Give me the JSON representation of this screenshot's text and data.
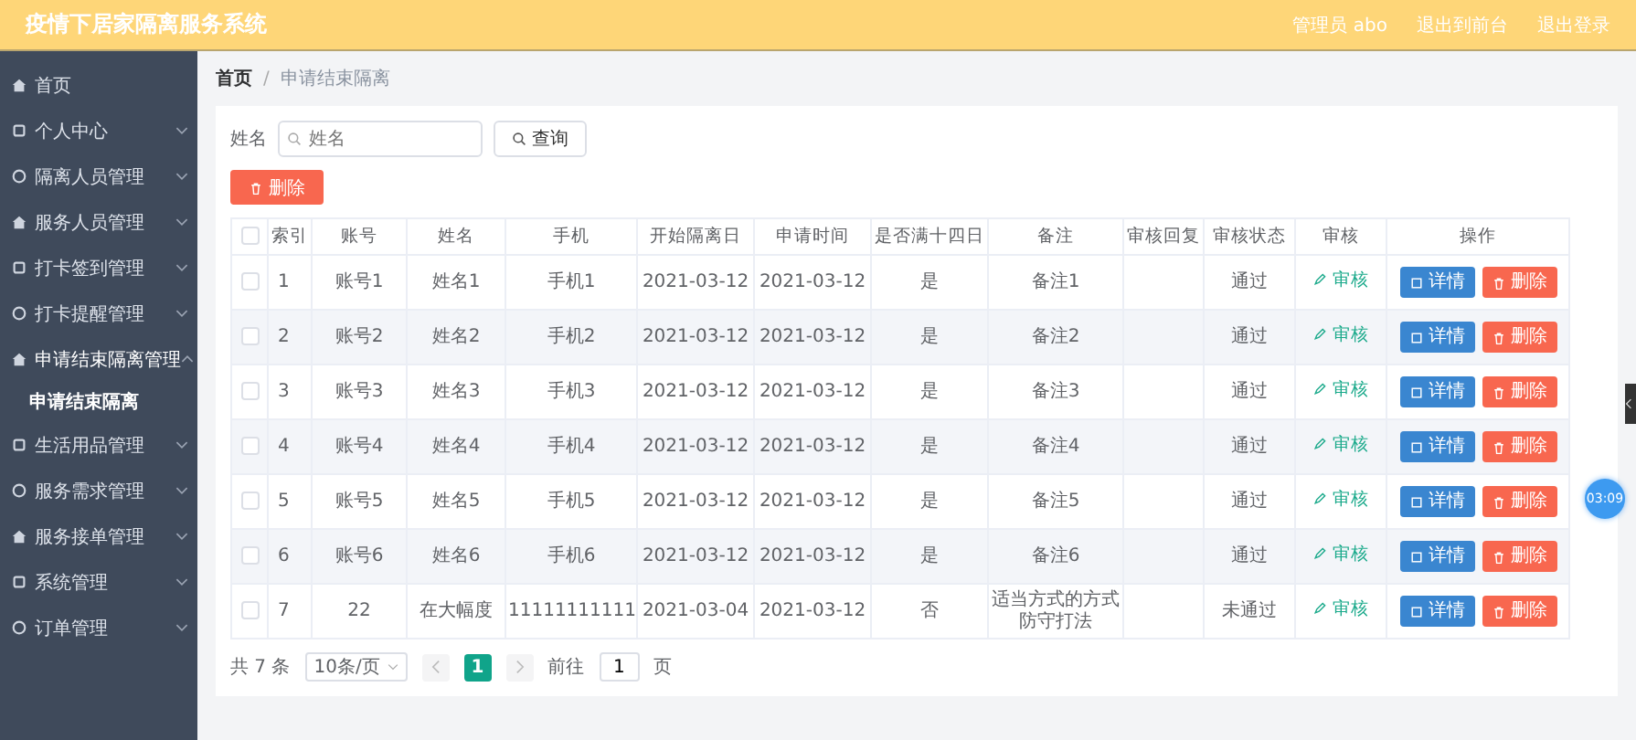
{
  "header": {
    "title": "疫情下居家隔离服务系统",
    "user": "管理员 abo",
    "links": [
      "退出到前台",
      "退出登录"
    ]
  },
  "sidebar": {
    "items": [
      {
        "label": "首页"
      },
      {
        "label": "个人中心",
        "expanded": false
      },
      {
        "label": "隔离人员管理",
        "expanded": false
      },
      {
        "label": "服务人员管理",
        "expanded": false
      },
      {
        "label": "打卡签到管理",
        "expanded": false
      },
      {
        "label": "打卡提醒管理",
        "expanded": false
      },
      {
        "label": "申请结束隔离管理",
        "expanded": true,
        "children": [
          {
            "label": "申请结束隔离",
            "selected": true
          }
        ]
      },
      {
        "label": "生活用品管理",
        "expanded": false
      },
      {
        "label": "服务需求管理",
        "expanded": false
      },
      {
        "label": "服务接单管理",
        "expanded": false
      },
      {
        "label": "系统管理",
        "expanded": false
      },
      {
        "label": "订单管理",
        "expanded": false
      }
    ]
  },
  "breadcrumb": {
    "items": [
      "首页",
      "申请结束隔离"
    ],
    "separator": "/"
  },
  "search": {
    "label": "姓名",
    "placeholder": "姓名",
    "button": "查询"
  },
  "delete_button": "删除",
  "table": {
    "header_checked": false,
    "columns": [
      "索引",
      "账号",
      "姓名",
      "手机",
      "开始隔离日",
      "申请时间",
      "是否满十四日",
      "备注",
      "审核回复",
      "审核状态",
      "审核",
      "操作"
    ],
    "rows": [
      {
        "checked": false,
        "cells": [
          "1",
          "账号1",
          "姓名1",
          "手机1",
          "2021-03-12",
          "2021-03-12",
          "是",
          "备注1",
          "",
          "通过"
        ],
        "review": "审核",
        "actions": [
          "详情",
          "删除"
        ]
      },
      {
        "checked": false,
        "cells": [
          "2",
          "账号2",
          "姓名2",
          "手机2",
          "2021-03-12",
          "2021-03-12",
          "是",
          "备注2",
          "",
          "通过"
        ],
        "review": "审核",
        "actions": [
          "详情",
          "删除"
        ]
      },
      {
        "checked": false,
        "cells": [
          "3",
          "账号3",
          "姓名3",
          "手机3",
          "2021-03-12",
          "2021-03-12",
          "是",
          "备注3",
          "",
          "通过"
        ],
        "review": "审核",
        "actions": [
          "详情",
          "删除"
        ]
      },
      {
        "checked": false,
        "cells": [
          "4",
          "账号4",
          "姓名4",
          "手机4",
          "2021-03-12",
          "2021-03-12",
          "是",
          "备注4",
          "",
          "通过"
        ],
        "review": "审核",
        "actions": [
          "详情",
          "删除"
        ]
      },
      {
        "checked": false,
        "cells": [
          "5",
          "账号5",
          "姓名5",
          "手机5",
          "2021-03-12",
          "2021-03-12",
          "是",
          "备注5",
          "",
          "通过"
        ],
        "review": "审核",
        "actions": [
          "详情",
          "删除"
        ]
      },
      {
        "checked": false,
        "cells": [
          "6",
          "账号6",
          "姓名6",
          "手机6",
          "2021-03-12",
          "2021-03-12",
          "是",
          "备注6",
          "",
          "通过"
        ],
        "review": "审核",
        "actions": [
          "详情",
          "删除"
        ]
      },
      {
        "checked": false,
        "cells": [
          "7",
          "22",
          "在大幅度",
          "11111111111",
          "2021-03-04",
          "2021-03-12",
          "否",
          "适当方式的方式防守打法",
          "",
          "未通过"
        ],
        "review": "审核",
        "actions": [
          "详情",
          "删除"
        ]
      }
    ]
  },
  "pagination": {
    "total": "共 7 条",
    "page_size": "10条/页",
    "pages": [
      {
        "label": "1",
        "selected": true
      }
    ],
    "goto_label": "前往",
    "goto_value": "1",
    "suffix": "页"
  },
  "timer_badge": "03:09"
}
